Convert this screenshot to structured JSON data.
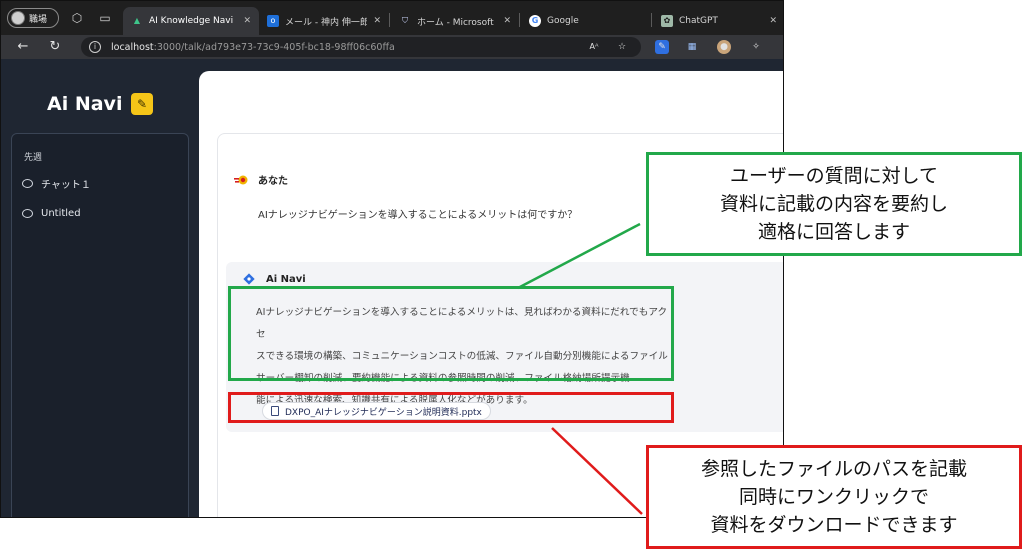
{
  "browser": {
    "profile_label": "職場",
    "tabs": [
      {
        "title": "AI Knowledge Navi",
        "active": true
      },
      {
        "title": "メール - 神内 伸一郎 -",
        "active": false
      },
      {
        "title": "ホーム - Microsoft Defe",
        "active": false
      },
      {
        "title": "Google",
        "active": false
      },
      {
        "title": "ChatGPT",
        "active": false
      }
    ],
    "url_host": "localhost",
    "url_path": ":3000/talk/ad793e73-73c9-405f-bc18-98ff06c60ffa",
    "reader_glyph": "Aᴬ",
    "star_glyph": "☆"
  },
  "sidebar": {
    "brand": "Ai Navi",
    "section_label": "先週",
    "items": [
      {
        "label": "チャット１"
      },
      {
        "label": "Untitled"
      }
    ]
  },
  "chat": {
    "user_name": "あなた",
    "question": "AIナレッジナビゲーションを導入することによるメリットは何ですか？",
    "ai_name": "Ai Navi",
    "answer_lines": [
      "AIナレッジナビゲーションを導入することによるメリットは、見ればわかる資料にだれでもアクセ",
      "スできる環境の構築、コミュニケーションコストの低減、ファイル自動分別機能によるファイル",
      "サーバー棚卸の削減、要約機能による資料の参照時間の削減、ファイル格納場所提示機",
      "能による迅速な検索、知識共有による脱属人化などがあります。"
    ],
    "file_name": "DXPO_AIナレッジナビゲーション説明資料.pptx"
  },
  "annotations": {
    "green_callout": [
      "ユーザーの質問に対して",
      "資料に記載の内容を要約し",
      "適格に回答します"
    ],
    "red_callout": [
      "参照したファイルのパスを記載",
      "同時にワンクリックで",
      "資料をダウンロードできます"
    ],
    "green_color": "#22a84a",
    "red_color": "#e01b1b"
  },
  "colors": {
    "sidebar_bg": "#1f2632",
    "brand_badge": "#f5c518",
    "ai_diamond": "#2f6fe0"
  }
}
